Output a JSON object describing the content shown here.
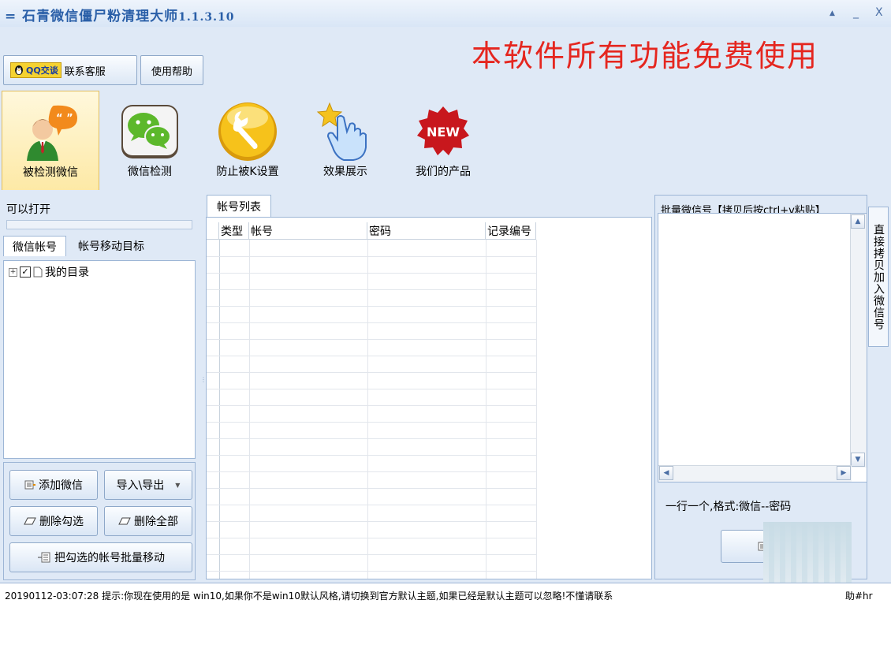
{
  "window": {
    "title": "石青微信僵尸粉清理大师",
    "version": "1.1.3.10",
    "menu_glyph": "=",
    "minimize_glyph": "▲",
    "dash_glyph": "_",
    "close_glyph": "X"
  },
  "promo": "本软件所有功能免费使用",
  "toolbar": {
    "qq_badge": "QQ交谈",
    "contact_label": "联系客服",
    "help_label": "使用帮助"
  },
  "ribbon": [
    {
      "label": "被检测微信",
      "icon": "user-chat-icon"
    },
    {
      "label": "微信检测",
      "icon": "wechat-icon"
    },
    {
      "label": "防止被K设置",
      "icon": "wrench-icon"
    },
    {
      "label": "效果展示",
      "icon": "hand-star-icon"
    },
    {
      "label": "我们的产品",
      "icon": "new-badge-icon",
      "badge_text": "NEW"
    }
  ],
  "left": {
    "status_label": "可以打开",
    "tabs": [
      "微信帐号",
      "帐号移动目标"
    ],
    "tree": {
      "label": "我的目录",
      "checked": true,
      "expander": "+"
    },
    "buttons": {
      "add": "添加微信",
      "import_export": "导入\\导出",
      "delete_checked": "删除勾选",
      "delete_all": "删除全部",
      "batch_move": "把勾选的帐号批量移动"
    }
  },
  "middle": {
    "tab_label": "帐号列表",
    "columns": [
      "类型",
      "帐号",
      "密码",
      "记录编号"
    ],
    "rows": []
  },
  "right": {
    "batch_label": "批量微信号【拷贝后按ctrl+v粘贴】",
    "side_tab": "直接拷贝加入微信号",
    "format_hint": "一行一个,格式:微信--密码",
    "add_button": "添加"
  },
  "status": {
    "text": "20190112-03:07:28  提示:你现在使用的是 win10,如果你不是win10默认风格,请切换到官方默认主题,如果已经是默认主题可以忽略!不懂请联系",
    "tail": "助#hr"
  },
  "colors": {
    "title": "#2a5fa8",
    "promo": "#e5261f",
    "panel_bg": "#dfe9f6"
  }
}
